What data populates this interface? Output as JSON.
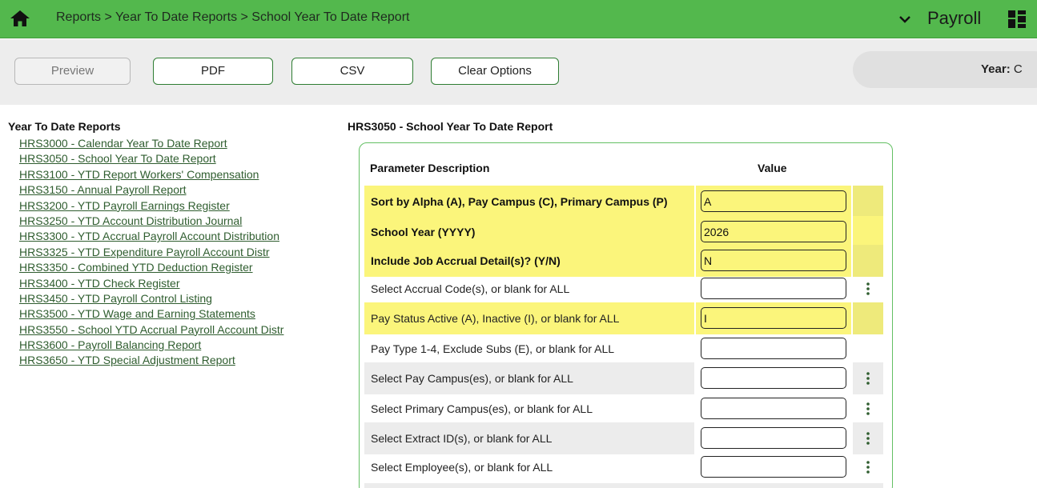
{
  "header": {
    "breadcrumb": "Reports > Year To Date Reports > School Year To Date Report",
    "app_title": "Payroll",
    "bar_color": "#53b84d"
  },
  "toolbar": {
    "preview_label": "Preview",
    "pdf_label": "PDF",
    "csv_label": "CSV",
    "clear_label": "Clear Options",
    "year_label": "Year:",
    "year_value": "C"
  },
  "nav": {
    "title": "Year To Date Reports",
    "items": [
      "HRS3000 - Calendar Year To Date Report",
      "HRS3050 - School Year To Date Report",
      "HRS3100 - YTD Report Workers' Compensation",
      "HRS3150 - Annual Payroll Report",
      "HRS3200 - YTD Payroll Earnings Register",
      "HRS3250 - YTD Account Distribution Journal",
      "HRS3300 - YTD Accrual Payroll Account Distribution",
      "HRS3325 - YTD Expenditure Payroll Account Distr",
      "HRS3350 - Combined YTD Deduction Register",
      "HRS3400 - YTD Check Register",
      "HRS3450 - YTD Payroll Control Listing",
      "HRS3500 - YTD Wage and Earning Statements",
      "HRS3550 - School YTD Accrual Payroll Account Distr",
      "HRS3600 - Payroll Balancing Report",
      "HRS3650 - YTD Special Adjustment Report"
    ]
  },
  "report": {
    "title": "HRS3050 - School Year To Date Report",
    "col_description": "Parameter Description",
    "col_value": "Value",
    "params": [
      {
        "description": "Sort by Alpha (A), Pay Campus (C), Primary Campus (P)",
        "value": "A"
      },
      {
        "description": "School Year (YYYY)",
        "value": "2026"
      },
      {
        "description": "Include Job Accrual Detail(s)? (Y/N)",
        "value": "N"
      },
      {
        "description": "Select Accrual Code(s), or blank for ALL",
        "value": ""
      },
      {
        "description": "Pay Status Active (A), Inactive (I), or blank for ALL",
        "value": "I"
      },
      {
        "description": "Pay Type 1-4, Exclude Subs (E), or blank for ALL",
        "value": ""
      },
      {
        "description": "Select Pay Campus(es), or blank for ALL",
        "value": ""
      },
      {
        "description": "Select Primary Campus(es), or blank for ALL",
        "value": ""
      },
      {
        "description": "Select Extract ID(s), or blank for ALL",
        "value": ""
      },
      {
        "description": "Select Employee(s), or blank for ALL",
        "value": ""
      }
    ]
  },
  "colors": {
    "highlight": "#fbf57b",
    "accent": "#2e7d32"
  }
}
